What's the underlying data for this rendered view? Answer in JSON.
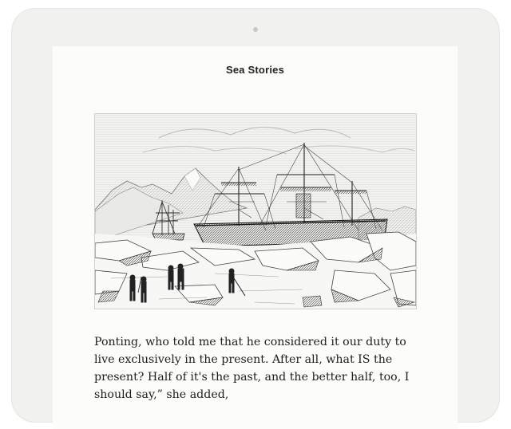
{
  "book": {
    "title": "Sea Stories"
  },
  "content": {
    "passage": "Ponting, who told me that he considered it our duty to live exclusively in the present. After all, what IS the present? Half of it's the past, and the better half, too, I should say,” she added,"
  },
  "colors": {
    "device_frame": "#f1f1ef",
    "screen_background": "#fcfcfb",
    "text": "#1e1e1e"
  }
}
